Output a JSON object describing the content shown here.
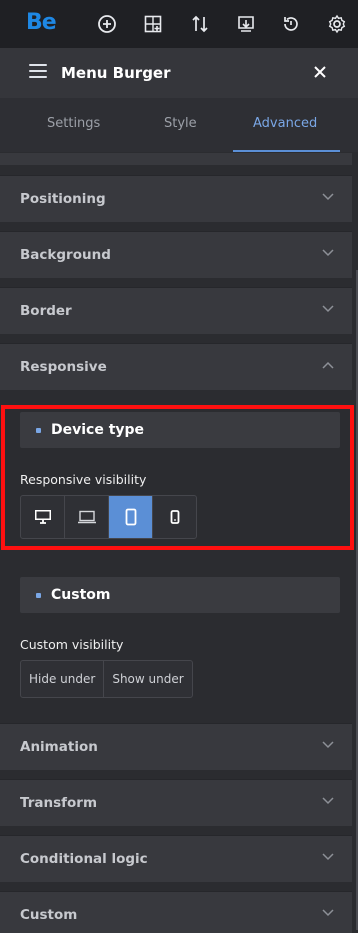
{
  "app": {
    "logo": "Be"
  },
  "toolbar": {
    "icons": [
      "add-icon",
      "add-section-icon",
      "sort-icon",
      "import-icon",
      "history-icon",
      "settings-icon"
    ]
  },
  "header": {
    "title": "Menu Burger"
  },
  "tabs": [
    {
      "label": "Settings",
      "active": false
    },
    {
      "label": "Style",
      "active": false
    },
    {
      "label": "Advanced",
      "active": true
    }
  ],
  "sections": {
    "positioning": "Positioning",
    "background": "Background",
    "border": "Border",
    "responsive": "Responsive",
    "animation": "Animation",
    "transform": "Transform",
    "conditional": "Conditional logic",
    "custom": "Custom"
  },
  "responsive": {
    "device_type": {
      "heading": "Device type",
      "label": "Responsive visibility",
      "devices": [
        {
          "icon": "desktop-icon",
          "active": false
        },
        {
          "icon": "laptop-icon",
          "active": false
        },
        {
          "icon": "tablet-icon",
          "active": true
        },
        {
          "icon": "mobile-icon",
          "active": false
        }
      ]
    },
    "custom": {
      "heading": "Custom",
      "label": "Custom visibility",
      "options": [
        "Hide under",
        "Show under"
      ]
    }
  },
  "colors": {
    "accent": "#5b8fd6",
    "highlight": "#ff1010",
    "logo": "#1e88e5"
  }
}
